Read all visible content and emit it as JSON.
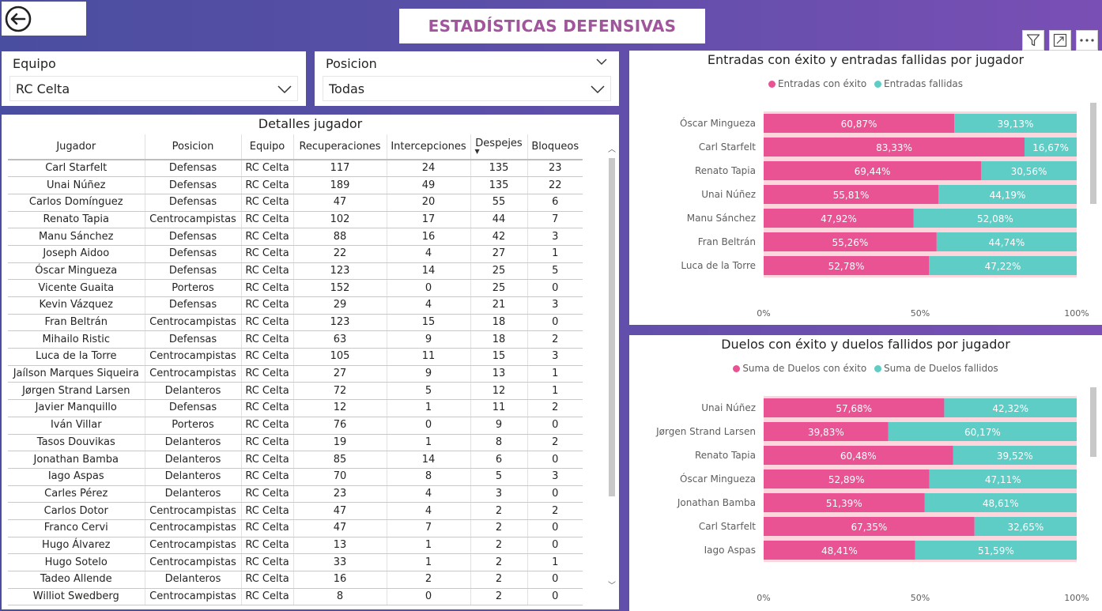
{
  "title": "ESTADÍSTICAS DEFENSIVAS",
  "colors": {
    "success": "#ea5393",
    "fail": "#5dcdc6",
    "track": "#fcd6dc",
    "title": "#a0559c"
  },
  "slicers": {
    "equipo": {
      "label": "Equipo",
      "value": "RC Celta"
    },
    "posicion": {
      "label": "Posicion",
      "value": "Todas"
    }
  },
  "table": {
    "title": "Detalles jugador",
    "columns": [
      "Jugador",
      "Posicion",
      "Equipo",
      "Recuperaciones",
      "Intercepciones",
      "Despejes",
      "Bloqueos"
    ],
    "rows": [
      [
        "Carl Starfelt",
        "Defensas",
        "RC Celta",
        "117",
        "24",
        "135",
        "23"
      ],
      [
        "Unai Núñez",
        "Defensas",
        "RC Celta",
        "189",
        "49",
        "135",
        "22"
      ],
      [
        "Carlos Domínguez",
        "Defensas",
        "RC Celta",
        "47",
        "20",
        "55",
        "6"
      ],
      [
        "Renato Tapia",
        "Centrocampistas",
        "RC Celta",
        "102",
        "17",
        "44",
        "7"
      ],
      [
        "Manu Sánchez",
        "Defensas",
        "RC Celta",
        "88",
        "16",
        "42",
        "3"
      ],
      [
        "Joseph Aidoo",
        "Defensas",
        "RC Celta",
        "22",
        "4",
        "27",
        "1"
      ],
      [
        "Óscar Mingueza",
        "Defensas",
        "RC Celta",
        "123",
        "14",
        "25",
        "5"
      ],
      [
        "Vicente Guaita",
        "Porteros",
        "RC Celta",
        "152",
        "0",
        "25",
        "0"
      ],
      [
        "Kevin Vázquez",
        "Defensas",
        "RC Celta",
        "29",
        "4",
        "21",
        "3"
      ],
      [
        "Fran Beltrán",
        "Centrocampistas",
        "RC Celta",
        "123",
        "15",
        "18",
        "0"
      ],
      [
        "Mihailo Ristic",
        "Defensas",
        "RC Celta",
        "63",
        "9",
        "18",
        "2"
      ],
      [
        "Luca de la Torre",
        "Centrocampistas",
        "RC Celta",
        "105",
        "11",
        "15",
        "3"
      ],
      [
        "Jaílson Marques Siqueira",
        "Centrocampistas",
        "RC Celta",
        "27",
        "9",
        "13",
        "1"
      ],
      [
        "Jørgen Strand Larsen",
        "Delanteros",
        "RC Celta",
        "72",
        "5",
        "12",
        "1"
      ],
      [
        "Javier Manquillo",
        "Defensas",
        "RC Celta",
        "12",
        "1",
        "11",
        "2"
      ],
      [
        "Iván Villar",
        "Porteros",
        "RC Celta",
        "76",
        "0",
        "9",
        "0"
      ],
      [
        "Tasos Douvikas",
        "Delanteros",
        "RC Celta",
        "19",
        "1",
        "8",
        "2"
      ],
      [
        "Jonathan Bamba",
        "Delanteros",
        "RC Celta",
        "85",
        "14",
        "6",
        "0"
      ],
      [
        "Iago Aspas",
        "Delanteros",
        "RC Celta",
        "70",
        "8",
        "5",
        "3"
      ],
      [
        "Carles Pérez",
        "Delanteros",
        "RC Celta",
        "23",
        "4",
        "3",
        "0"
      ],
      [
        "Carlos Dotor",
        "Centrocampistas",
        "RC Celta",
        "47",
        "4",
        "2",
        "2"
      ],
      [
        "Franco Cervi",
        "Centrocampistas",
        "RC Celta",
        "47",
        "7",
        "2",
        "0"
      ],
      [
        "Hugo Álvarez",
        "Centrocampistas",
        "RC Celta",
        "13",
        "1",
        "2",
        "0"
      ],
      [
        "Hugo Sotelo",
        "Centrocampistas",
        "RC Celta",
        "33",
        "1",
        "2",
        "1"
      ],
      [
        "Tadeo Allende",
        "Delanteros",
        "RC Celta",
        "16",
        "2",
        "2",
        "0"
      ],
      [
        "Williot Swedberg",
        "Centrocampistas",
        "RC Celta",
        "8",
        "0",
        "2",
        "0"
      ]
    ]
  },
  "chart_data": [
    {
      "type": "bar",
      "stacked": "100%",
      "orientation": "horizontal",
      "title": "Entradas con éxito y entradas fallidas por jugador",
      "categories": [
        "Óscar Mingueza",
        "Carl Starfelt",
        "Renato Tapia",
        "Unai Núñez",
        "Manu Sánchez",
        "Fran Beltrán",
        "Luca de la Torre"
      ],
      "series": [
        {
          "name": "Entradas con éxito",
          "values": [
            60.87,
            83.33,
            69.44,
            55.81,
            47.92,
            55.26,
            52.78
          ],
          "labels": [
            "60,87%",
            "83,33%",
            "69,44%",
            "55,81%",
            "47,92%",
            "55,26%",
            "52,78%"
          ]
        },
        {
          "name": "Entradas fallidas",
          "values": [
            39.13,
            16.67,
            30.56,
            44.19,
            52.08,
            44.74,
            47.22
          ],
          "labels": [
            "39,13%",
            "16,67%",
            "30,56%",
            "44,19%",
            "52,08%",
            "44,74%",
            "47,22%"
          ]
        }
      ],
      "xticks": [
        "0%",
        "50%",
        "100%"
      ],
      "xlim": [
        0,
        100
      ],
      "legend": "top"
    },
    {
      "type": "bar",
      "stacked": "100%",
      "orientation": "horizontal",
      "title": "Duelos con éxito y duelos fallidos por jugador",
      "categories": [
        "Unai Núñez",
        "Jørgen Strand Larsen",
        "Renato Tapia",
        "Óscar Mingueza",
        "Jonathan Bamba",
        "Carl Starfelt",
        "Iago Aspas"
      ],
      "series": [
        {
          "name": "Suma de Duelos con éxito",
          "values": [
            57.68,
            39.83,
            60.48,
            52.89,
            51.39,
            67.35,
            48.41
          ],
          "labels": [
            "57,68%",
            "39,83%",
            "60,48%",
            "52,89%",
            "51,39%",
            "67,35%",
            "48,41%"
          ]
        },
        {
          "name": "Suma de Duelos fallidos",
          "values": [
            42.32,
            60.17,
            39.52,
            47.11,
            48.61,
            32.65,
            51.59
          ],
          "labels": [
            "42,32%",
            "60,17%",
            "39,52%",
            "47,11%",
            "48,61%",
            "32,65%",
            "51,59%"
          ]
        }
      ],
      "xticks": [
        "0%",
        "50%",
        "100%"
      ],
      "xlim": [
        0,
        100
      ],
      "legend": "top"
    }
  ]
}
